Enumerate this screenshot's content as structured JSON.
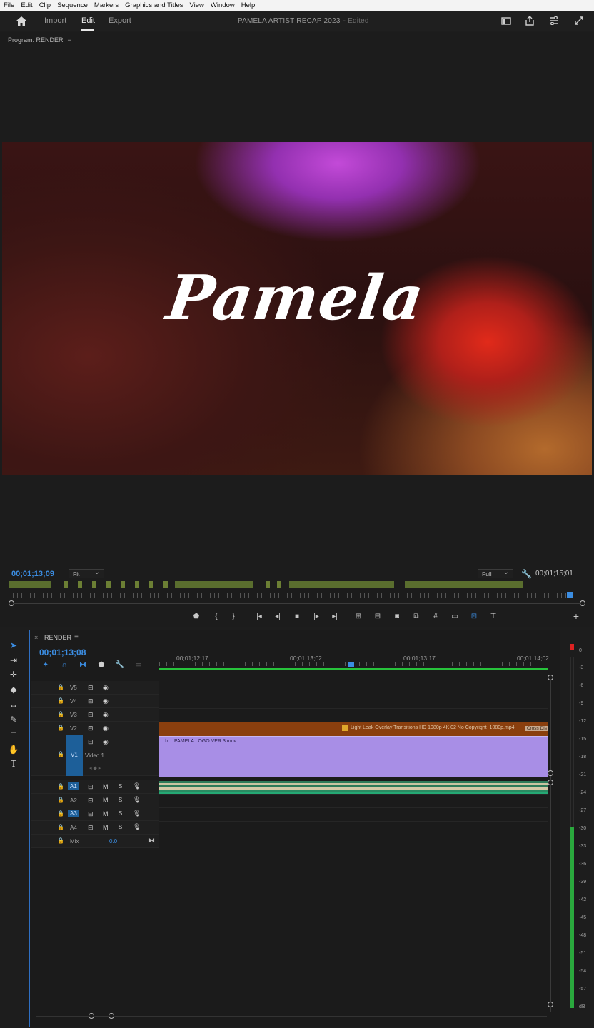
{
  "menubar": [
    "File",
    "Edit",
    "Clip",
    "Sequence",
    "Markers",
    "Graphics and Titles",
    "View",
    "Window",
    "Help"
  ],
  "header": {
    "tabs": {
      "import": "Import",
      "edit": "Edit",
      "export": "Export"
    },
    "project_title": "PAMELA ARTIST RECAP 2023",
    "project_status": "- Edited",
    "icons": [
      "home-icon",
      "panel-icon",
      "share-icon",
      "settings-icon",
      "fullscreen-icon"
    ]
  },
  "program": {
    "title": "Program: RENDER",
    "menu_glyph": "≡",
    "video_title": "Pamela",
    "timecode": "00;01;13;09",
    "fit": "Fit",
    "quality": "Full",
    "duration": "00;01;15;01",
    "transport": [
      "marker-icon",
      "mark-in-icon",
      "mark-out-icon",
      "go-to-in-icon",
      "step-back-icon",
      "stop-icon",
      "step-forward-icon",
      "go-to-out-icon",
      "insert-icon",
      "overwrite-icon",
      "export-frame-icon",
      "compare-icon",
      "safe-margins-icon",
      "vr-icon",
      "proxy-icon",
      "multicam-icon",
      "add-button"
    ]
  },
  "timeline": {
    "close": "×",
    "name": "RENDER",
    "menu_glyph": "≡",
    "timecode": "00;01;13;08",
    "ruler": [
      "00;01;12;17",
      "00;01;13;02",
      "00;01;13;17",
      "00;01;14;02"
    ],
    "video_tracks": [
      {
        "name": "V5"
      },
      {
        "name": "V4"
      },
      {
        "name": "V3"
      },
      {
        "name": "V2"
      },
      {
        "name": "V1",
        "label": "Video 1"
      }
    ],
    "audio_tracks": [
      {
        "name": "A1",
        "m": "M",
        "s": "S"
      },
      {
        "name": "A2",
        "m": "M",
        "s": "S"
      },
      {
        "name": "A3",
        "m": "M",
        "s": "S"
      },
      {
        "name": "A4",
        "m": "M",
        "s": "S"
      }
    ],
    "mix": {
      "label": "Mix",
      "value": "0.0"
    },
    "clips": {
      "v2": "Light Leak Overlay  Transitions  HD 1080p 4K  02 No Copyright_1080p.mp4",
      "v2_cross": "Cross Dis",
      "v1": "PAMELA LOGO VER 3.mov",
      "v1_fx": "fx"
    }
  },
  "meter": {
    "scale": [
      "0",
      "-3",
      "-6",
      "-9",
      "-12",
      "-15",
      "-18",
      "-21",
      "-24",
      "-27",
      "-30",
      "-33",
      "-36",
      "-39",
      "-42",
      "-45",
      "-48",
      "-51",
      "-54",
      "-57",
      "dB"
    ],
    "clip_indicator": "#dd2222",
    "level_color": "#2aa83d"
  }
}
